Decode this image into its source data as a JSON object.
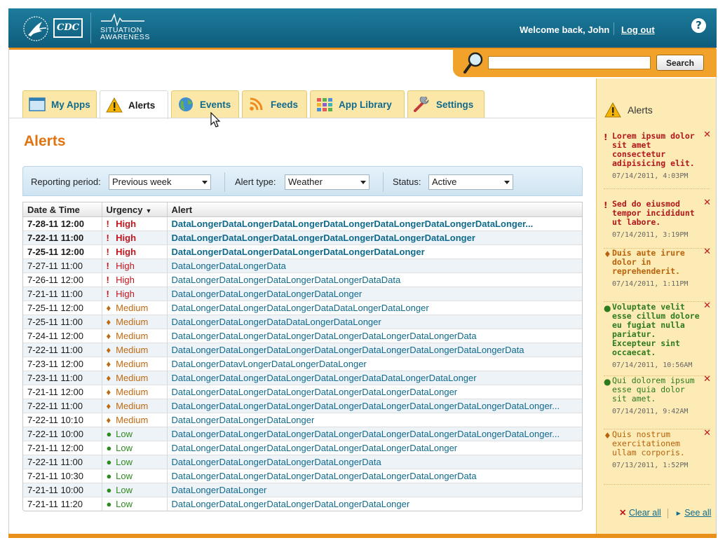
{
  "brand": {
    "logo_text": "CDC",
    "product_line1": "SITUATION",
    "product_line2": "AWARENESS"
  },
  "header": {
    "welcome": "Welcome back, John",
    "logout": "Log out",
    "help": "?"
  },
  "search": {
    "value": "",
    "button": "Search"
  },
  "tabs": [
    {
      "label": "My Apps",
      "icon": "window-icon"
    },
    {
      "label": "Alerts",
      "icon": "warning-icon"
    },
    {
      "label": "Events",
      "icon": "globe-icon"
    },
    {
      "label": "Feeds",
      "icon": "rss-icon"
    },
    {
      "label": "App Library",
      "icon": "grid-icon"
    },
    {
      "label": "Settings",
      "icon": "wrench-icon"
    }
  ],
  "active_tab": "Alerts",
  "page": {
    "title": "Alerts"
  },
  "filters": {
    "period_label": "Reporting period:",
    "period_value": "Previous week",
    "type_label": "Alert type:",
    "type_value": "Weather",
    "status_label": "Status:",
    "status_value": "Active"
  },
  "table": {
    "columns": [
      "Date & Time",
      "Urgency",
      "Alert"
    ],
    "rows": [
      {
        "date": "7-28-11 12:00",
        "urgency": "High",
        "alert": "DataLongerDataLongerDataLongerDataLongerDataLongerDataLongerDataLonger...",
        "unread": true
      },
      {
        "date": "7-22-11 11:00",
        "urgency": "High",
        "alert": "DataLongerDataLongerDataLongerDataLongerDataLongerDataLonger",
        "unread": true
      },
      {
        "date": "7-25-11 12:00",
        "urgency": "High",
        "alert": "DataLongerDataLongerDataLongerDataLongerDataLonger",
        "unread": true
      },
      {
        "date": "7-27-11 11:00",
        "urgency": "High",
        "alert": "DataLongerDataLongerData",
        "unread": false
      },
      {
        "date": "7-26-11 12:00",
        "urgency": "High",
        "alert": "DataLongerDataLongerDataLongerDataLongerDataData",
        "unread": false
      },
      {
        "date": "7-21-11 11:00",
        "urgency": "High",
        "alert": "DataLongerDataLongerDataLongerDataLonger",
        "unread": false
      },
      {
        "date": "7-25-11 12:00",
        "urgency": "Medium",
        "alert": "DataLongerDataLongerDataLongerDataDataLongerDataLonger",
        "unread": false
      },
      {
        "date": "7-25-11 11:00",
        "urgency": "Medium",
        "alert": "DataLongerDataLongerDataDataLongerDataLonger",
        "unread": false
      },
      {
        "date": "7-24-11 12:00",
        "urgency": "Medium",
        "alert": "DataLongerDataLongerDataLongerDataLongerDataLongerDataLongerData",
        "unread": false
      },
      {
        "date": "7-22-11 11:00",
        "urgency": "Medium",
        "alert": "DataLongerDataLongerDataLongerDataLongerDataLongerDataLongerDataLongerData",
        "unread": false
      },
      {
        "date": "7-23-11 12:00",
        "urgency": "Medium",
        "alert": "DataLongerDatavLongerDataLongerDataLonger",
        "unread": false
      },
      {
        "date": "7-23-11 11:00",
        "urgency": "Medium",
        "alert": "DataLongerDataLongerDataLongerDataLongerDataDataLongerDataLonger",
        "unread": false
      },
      {
        "date": "7-21-11 12:00",
        "urgency": "Medium",
        "alert": "DataLongerDataLongerDataLongerDataLongerDataLongerDataLonger",
        "unread": false
      },
      {
        "date": "7-22-11 11:00",
        "urgency": "Medium",
        "alert": "DataLongerDataLongerDataLongerDataLongerDataLongerDataLongerDataLongerDataLonger...",
        "unread": false
      },
      {
        "date": "7-22-11 10:10",
        "urgency": "Medium",
        "alert": "DataLongerDataLongerDataLonger",
        "unread": false
      },
      {
        "date": "7-22-11 10:00",
        "urgency": "Low",
        "alert": "DataLongerDataLongerDataLongerDataLongerDataLongerDataLongerDataLongerDataLonger...",
        "unread": false
      },
      {
        "date": "7-21-11 12:00",
        "urgency": "Low",
        "alert": "DataLongerDataLongerDataLongerDataLongerDataLongerDataLonger",
        "unread": false
      },
      {
        "date": "7-22-11 11:00",
        "urgency": "Low",
        "alert": "DataLongerDataLongerDataLongerDataLongerData",
        "unread": false
      },
      {
        "date": "7-21-11 10:30",
        "urgency": "Low",
        "alert": "DataLongerDataLongerDataLongerDataLongerDataLongerDataLongerData",
        "unread": false
      },
      {
        "date": "7-21-11 10:00",
        "urgency": "Low",
        "alert": "DataLongerDataLonger",
        "unread": false
      },
      {
        "date": "7-21-11 11:20",
        "urgency": "Low",
        "alert": "DataLongerDataLongerDataLongerDataLongerDataLonger",
        "unread": false
      }
    ]
  },
  "sidebar": {
    "title": "Alerts",
    "items": [
      {
        "mark": "!",
        "level": "high",
        "text": "Lorem ipsum dolor sit amet consectetur adipisicing elit.",
        "time": "07/14/2011, 4:03PM",
        "unread": true
      },
      {
        "mark": "!",
        "level": "high",
        "text": "Sed do eiusmod tempor incididunt ut labore.",
        "time": "07/14/2011, 3:19PM",
        "unread": true
      },
      {
        "mark": "♦",
        "level": "medium",
        "text": "Duis aute irure dolor in reprehenderit.",
        "time": "07/14/2011, 1:11PM",
        "unread": true
      },
      {
        "mark": "●",
        "level": "low",
        "text": "Voluptate velit esse cillum dolore eu fugiat nulla pariatur. Excepteur sint occaecat.",
        "time": "07/14/2011, 10:56AM",
        "unread": true
      },
      {
        "mark": "●",
        "level": "low",
        "text": "Qui dolorem ipsum esse quia dolor sit amet.",
        "time": "07/14/2011, 9:42AM",
        "unread": false
      },
      {
        "mark": "♦",
        "level": "medium",
        "text": "Quis nostrum exercitationem ullam corporis.",
        "time": "07/13/2011, 1:52PM",
        "unread": false
      }
    ],
    "clear_all": "Clear all",
    "see_all": "See all"
  },
  "colors": {
    "header": "#0f5c7c",
    "accent": "#e9901a",
    "high": "#c2161c",
    "medium": "#c06a10",
    "low": "#2d8a1e",
    "link": "#0f6a8c"
  }
}
